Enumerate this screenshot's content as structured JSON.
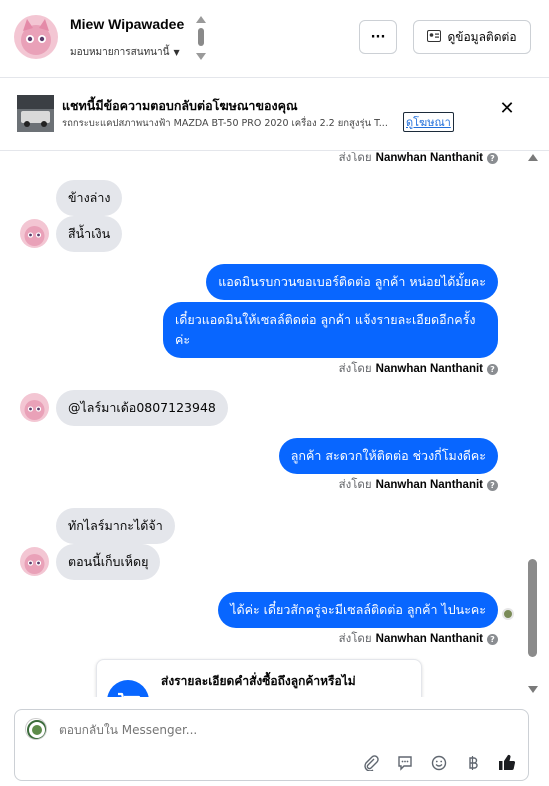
{
  "header": {
    "contact_name": "Miew Wipawadee",
    "assign_label": "มอบหมายการสนทนานี้",
    "more_label": "···",
    "contact_info_label": "ดูข้อมูลติดต่อ"
  },
  "ad": {
    "title": "แชทนี้มีข้อความตอบกลับต่อโฆษณาของคุณ",
    "subtitle": "รถกระบะแคปสภาพนางฟ้า MAZDA BT-50 PRO 2020 เครื่อง 2.2 ยกสูงรุ่น T...",
    "link_label": "ดูโฆษณา",
    "close_label": "✕"
  },
  "messages": {
    "sent_by_1": "ส่งโดย",
    "sender_1": "Nanwhan Nanthanit",
    "in_1": "ข้างล่าง",
    "in_2": "สีน้ำเงิน",
    "out_1": "แอดมินรบกวนขอเบอร์ติดต่อ ลูกค้า หน่อยได้มั้ยคะ",
    "out_2": "เดี๋ยวแอดมินให้เซลล์ติดต่อ ลูกค้า แจ้งรายละเอียดอีกครั้ง ค่ะ",
    "sent_by_2": "ส่งโดย",
    "sender_2": "Nanwhan Nanthanit",
    "in_3": "@ไลร์มาเด้อ0807123948",
    "out_3": "ลูกค้า สะดวกให้ติดต่อ ช่วงกี่โมงดีคะ",
    "sent_by_3": "ส่งโดย",
    "sender_3": "Nanwhan Nanthanit",
    "in_4": "ทักไลร์มากะได้จ้า",
    "in_5": "ตอนนี้เก็บเห็ดยุ",
    "out_4": "ได้ค่ะ  เดี๋ยวสักครู่จะมีเซลล์ติดต่อ ลูกค้า ไปนะคะ",
    "sent_by_4": "ส่งโดย",
    "sender_4": "Nanwhan Nanthanit",
    "card_title": "ส่งรายละเอียดคำสั่งซื้อถึงลูกค้าหรือไม่",
    "help_mark": "?"
  },
  "composer": {
    "placeholder": "ตอบกลับใน Messenger..."
  },
  "colors": {
    "outgoing_bubble": "#0866ff",
    "incoming_bubble": "#e4e6eb",
    "link": "#216fdb"
  },
  "icons": [
    "scroll-icon",
    "more-icon",
    "contact-card-icon",
    "close-icon",
    "help-icon",
    "cart-icon",
    "attach-icon",
    "saved-reply-icon",
    "emoji-icon",
    "baht-icon",
    "like-icon"
  ]
}
